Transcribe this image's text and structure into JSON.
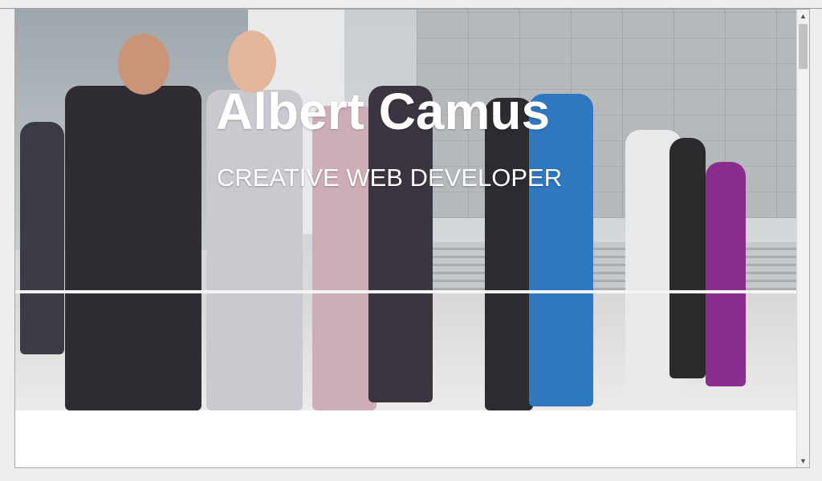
{
  "hero": {
    "title": "Albert Camus",
    "subtitle": "CREATIVE WEB DEVELOPER"
  },
  "scrollbar": {
    "up_icon": "▲",
    "down_icon": "▼"
  },
  "colors": {
    "title_text": "#ffffff",
    "page_background": "#ffffff",
    "scroll_thumb": "#c1c1c1"
  }
}
